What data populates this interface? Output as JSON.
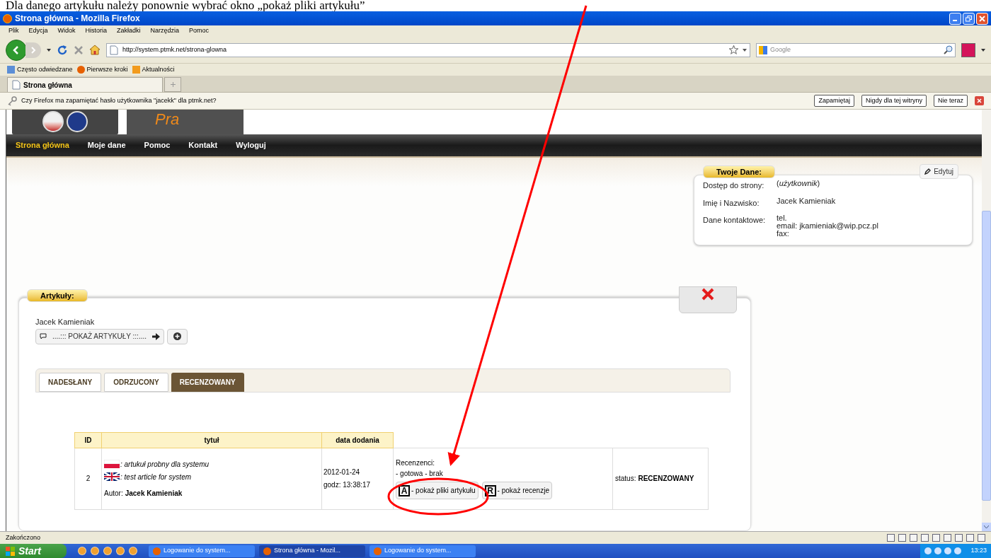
{
  "annotation": {
    "caption": "Dla danego artykułu należy ponownie wybrać okno „pokaż pliki artykułu”"
  },
  "window": {
    "title": "Strona główna - Mozilla Firefox"
  },
  "menu": [
    "Plik",
    "Edycja",
    "Widok",
    "Historia",
    "Zakładki",
    "Narzędzia",
    "Pomoc"
  ],
  "address": {
    "value": "http://system.ptmk.net/strona-glowna"
  },
  "search": {
    "placeholder": "Google"
  },
  "bookmarks": [
    "Często odwiedzane",
    "Pierwsze kroki",
    "Aktualności"
  ],
  "tabs": [
    {
      "label": "Strona główna",
      "selected": true
    }
  ],
  "password_bar": {
    "message": "Czy Firefox ma zapamiętać hasło użytkownika \"jacekk\" dla ptmk.net?",
    "buttons": [
      "Zapamiętaj",
      "Nigdy dla tej witryny",
      "Nie teraz"
    ]
  },
  "site": {
    "logo_text": "Pra",
    "nav": [
      {
        "label": "Strona główna",
        "selected": true
      },
      {
        "label": "Moje dane",
        "selected": false
      },
      {
        "label": "Pomoc",
        "selected": false
      },
      {
        "label": "Kontakt",
        "selected": false
      },
      {
        "label": "Wyloguj",
        "selected": false
      }
    ]
  },
  "profile": {
    "title": "Twoje Dane:",
    "edit": "Edytuj",
    "rows": [
      {
        "label": "Dostęp do strony:",
        "lines": [
          "(*użytkownik*)"
        ]
      },
      {
        "label": "Imię i Nazwisko:",
        "lines": [
          "Jacek Kamieniak"
        ]
      },
      {
        "label": "Dane kontaktowe:",
        "lines": [
          "tel.",
          "email: jkamieniak@wip.pcz.pl",
          "fax:"
        ]
      }
    ]
  },
  "articles": {
    "title": "Artykuły:",
    "user": "Jacek Kamieniak",
    "show_button": "....::: POKAŻ ARTYKUŁY :::....",
    "tabs": [
      {
        "label": "NADESŁANY",
        "selected": false
      },
      {
        "label": "ODRZUCONY",
        "selected": false
      },
      {
        "label": "RECENZOWANY",
        "selected": true
      }
    ],
    "table": {
      "columns": [
        "ID",
        "tytuł",
        "data dodania"
      ],
      "rows": [
        {
          "id": "2",
          "title_pl": ": artukuł probny dla systemu",
          "title_en": ": test article for system",
          "author_label": "Autor:",
          "author": "Jacek Kamieniak",
          "date": "2012-01-24",
          "time": "godz: 13:38:17",
          "reviews_label": "Recenzenci:",
          "reviews": "- gotowa - brak",
          "buttons": [
            {
              "key": "A",
              "label": "- pokaż pliki artykułu"
            },
            {
              "key": "R",
              "label": "- pokaż recenzje"
            }
          ],
          "status_label": "status:",
          "status": "RECENZOWANY"
        }
      ]
    }
  },
  "status_bar": {
    "text": "Zakończono"
  },
  "taskbar": {
    "start": "Start",
    "windows": [
      {
        "label": "Logowanie do system...",
        "selected": false
      },
      {
        "label": "Strona główna - Mozil...",
        "selected": true
      },
      {
        "label": "Logowanie do system...",
        "selected": false
      }
    ],
    "clock": "13:23"
  }
}
